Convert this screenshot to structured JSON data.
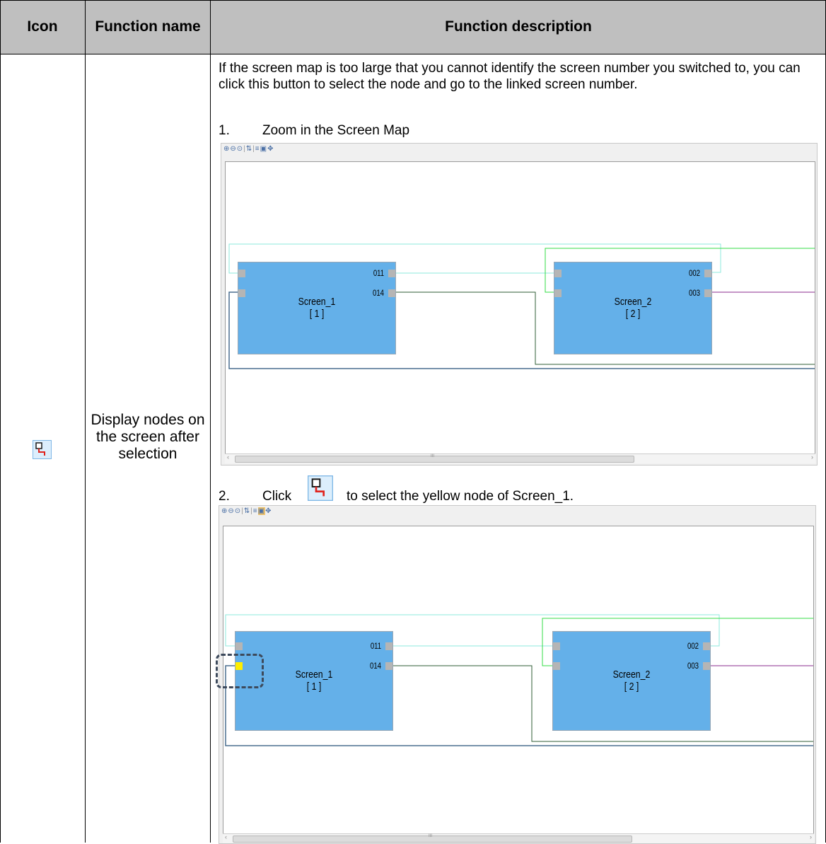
{
  "table": {
    "headers": {
      "icon": "Icon",
      "function_name": "Function name",
      "function_description": "Function description"
    },
    "row": {
      "icon_name": "display-nodes-icon",
      "function_name": "Display nodes on the screen after selection",
      "intro": "If the screen map is too large that you cannot identify the screen number you switched to, you can click this button to select the node and go to the linked screen number.",
      "step1": {
        "num": "1.",
        "text": "Zoom in the Screen Map"
      },
      "step2": {
        "num": "2.",
        "click_word": "Click",
        "text": "to select the yellow node of Screen_1."
      }
    }
  },
  "screen_map": {
    "toolbar_icons": [
      "zoom-in-icon",
      "zoom-out-icon",
      "zoom-fit-icon",
      "refresh-icon",
      "list-icon",
      "display-nodes-icon",
      "center-icon"
    ],
    "screens": [
      {
        "name": "Screen_1",
        "number": "[ 1 ]",
        "ports": [
          "011",
          "014"
        ]
      },
      {
        "name": "Screen_2",
        "number": "[ 2 ]",
        "ports": [
          "002",
          "003"
        ]
      }
    ],
    "scrollbar_grip": "III",
    "colors": {
      "node_fill": "#64b0e9",
      "selected_port": "#ffee00",
      "link_cyan": "#8ee8dc",
      "link_green": "#33dd44",
      "link_dark_green": "#2f5d35",
      "link_purple": "#8b2d8f",
      "link_steel": "#4a6f8f"
    }
  }
}
